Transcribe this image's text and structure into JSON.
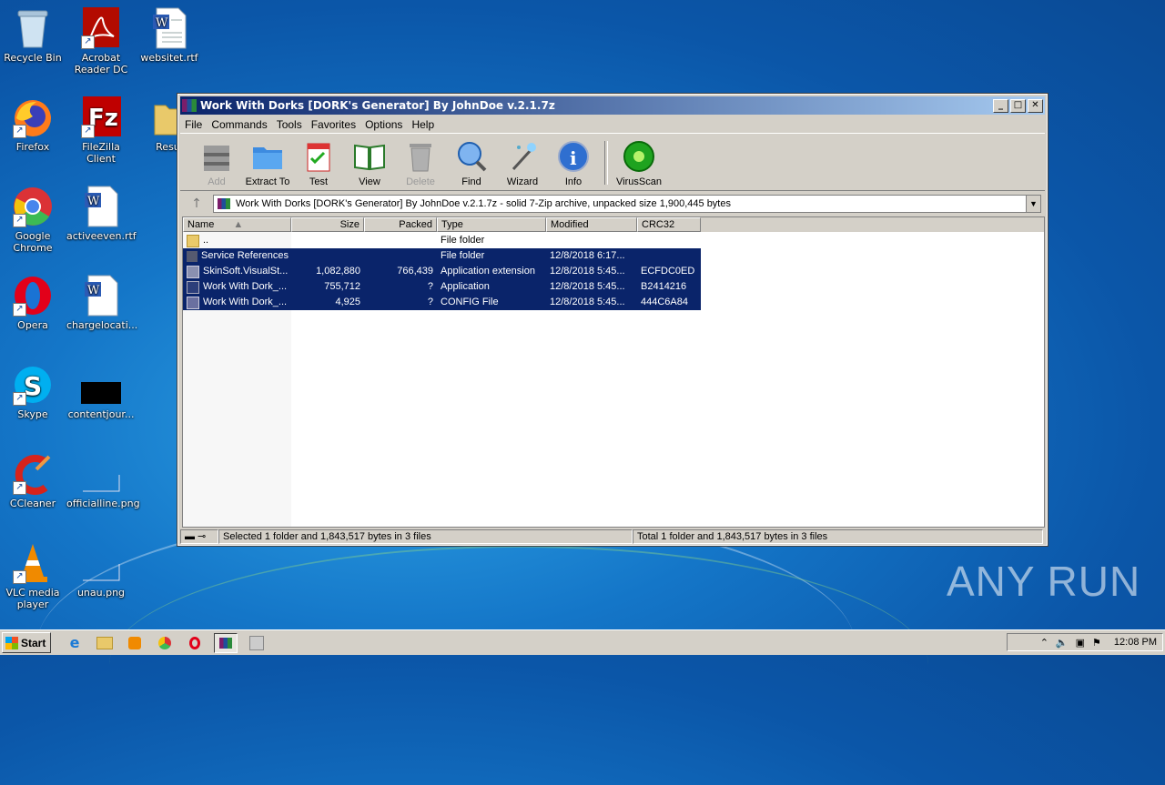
{
  "desktop": {
    "icons": [
      {
        "label": "Recycle Bin"
      },
      {
        "label": "Acrobat Reader DC"
      },
      {
        "label": "websitet.rtf"
      },
      {
        "label": "Firefox"
      },
      {
        "label": "FileZilla Client"
      },
      {
        "label": "Resul"
      },
      {
        "label": "Google Chrome"
      },
      {
        "label": "activeeven.rtf"
      },
      {
        "label": "Opera"
      },
      {
        "label": "chargelocati..."
      },
      {
        "label": "Skype"
      },
      {
        "label": "contentjour..."
      },
      {
        "label": "CCleaner"
      },
      {
        "label": "officialline.png"
      },
      {
        "label": "VLC media player"
      },
      {
        "label": "unau.png"
      }
    ]
  },
  "window": {
    "title": "Work With Dorks [DORK's Generator] By JohnDoe v.2.1.7z",
    "buttons": {
      "minimize": "_",
      "maximize": "□",
      "close": "✕"
    },
    "menu": [
      "File",
      "Commands",
      "Tools",
      "Favorites",
      "Options",
      "Help"
    ],
    "toolbar": [
      {
        "label": "Add",
        "disabled": true,
        "icon": "add-icon"
      },
      {
        "label": "Extract To",
        "disabled": false,
        "icon": "extract-icon"
      },
      {
        "label": "Test",
        "disabled": false,
        "icon": "test-icon"
      },
      {
        "label": "View",
        "disabled": false,
        "icon": "view-icon"
      },
      {
        "label": "Delete",
        "disabled": true,
        "icon": "delete-icon"
      },
      {
        "label": "Find",
        "disabled": false,
        "icon": "find-icon"
      },
      {
        "label": "Wizard",
        "disabled": false,
        "icon": "wizard-icon"
      },
      {
        "label": "Info",
        "disabled": false,
        "icon": "info-icon"
      },
      {
        "label": "VirusScan",
        "disabled": false,
        "icon": "virusscan-icon"
      }
    ],
    "address": "Work With Dorks [DORK's Generator] By JohnDoe v.2.1.7z - solid 7-Zip archive, unpacked size 1,900,445 bytes",
    "columns": [
      "Name",
      "Size",
      "Packed",
      "Type",
      "Modified",
      "CRC32"
    ],
    "files": [
      {
        "name": "..",
        "size": "",
        "packed": "",
        "type": "File folder",
        "modified": "",
        "crc": "",
        "selected": false
      },
      {
        "name": "Service References",
        "size": "",
        "packed": "",
        "type": "File folder",
        "modified": "12/8/2018 6:17...",
        "crc": "",
        "selected": true
      },
      {
        "name": "SkinSoft.VisualSt...",
        "size": "1,082,880",
        "packed": "766,439",
        "type": "Application extension",
        "modified": "12/8/2018 5:45...",
        "crc": "ECFDC0ED",
        "selected": true
      },
      {
        "name": "Work With Dork_...",
        "size": "755,712",
        "packed": "?",
        "type": "Application",
        "modified": "12/8/2018 5:45...",
        "crc": "B2414216",
        "selected": true
      },
      {
        "name": "Work With Dork_...",
        "size": "4,925",
        "packed": "?",
        "type": "CONFIG File",
        "modified": "12/8/2018 5:45...",
        "crc": "444C6A84",
        "selected": true
      }
    ],
    "status_left": "Selected 1 folder and 1,843,517 bytes in 3 files",
    "status_right": "Total 1 folder and 1,843,517 bytes in 3 files"
  },
  "taskbar": {
    "start": "Start",
    "clock": "12:08 PM"
  },
  "watermark": "ANY RUN"
}
